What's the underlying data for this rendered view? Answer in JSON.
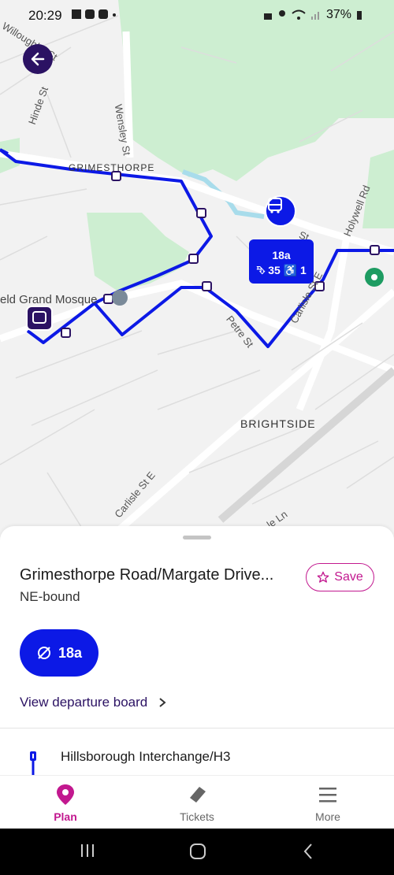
{
  "status": {
    "time": "20:29",
    "battery": "37%"
  },
  "map": {
    "streets": {
      "willoughby": "Willoughby St",
      "hinde": "Hinde St",
      "wensley": "Wensley St",
      "grimesthorpe": "GRIMESTHORPE",
      "holywell": "Holywell Rd",
      "mosque": "eld Grand Mosque",
      "petre": "Petre St",
      "carlisle_ne": "Carlisle St E",
      "brightside": "BRIGHTSIDE",
      "carlisle_sw": "Carlisle St E",
      "lane": "le Ln",
      "st": "St"
    },
    "route_color": "#0c19e6",
    "popup": {
      "route": "18a",
      "capacity": "⮷ 35 ♿ 1"
    }
  },
  "sheet": {
    "stop_name": "Grimesthorpe Road/Margate Drive...",
    "direction": "NE-bound",
    "save_label": "Save",
    "route_label": "18a",
    "view_departure_board": "View departure board",
    "next_stop": "Hillsborough Interchange/H3"
  },
  "tabs": [
    {
      "label": "Plan",
      "active": true
    },
    {
      "label": "Tickets",
      "active": false
    },
    {
      "label": "More",
      "active": false
    }
  ],
  "colors": {
    "accent": "#c2188f",
    "brand": "#2b1263",
    "bus": "#0c19e6"
  }
}
